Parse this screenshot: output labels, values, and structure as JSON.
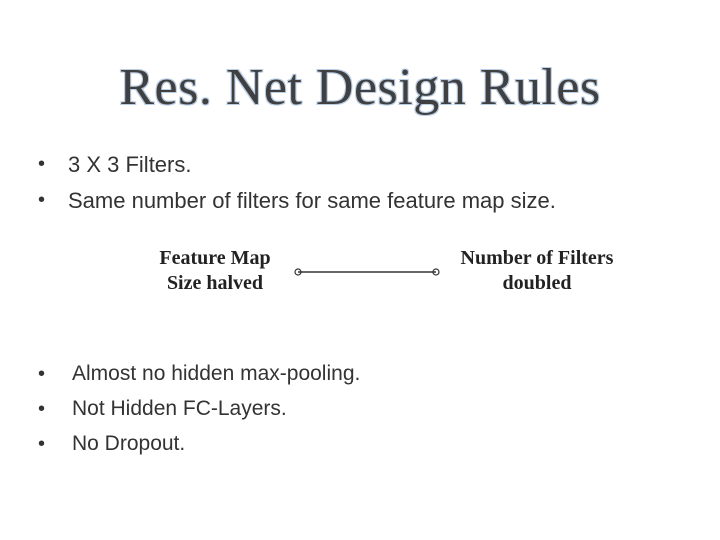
{
  "title": "Res. Net Design Rules",
  "bullets_top": [
    "3 X 3 Filters.",
    "Same number of filters for same feature map size."
  ],
  "diagram": {
    "left_line1": "Feature Map",
    "left_line2": "Size halved",
    "right_line1": "Number of Filters",
    "right_line2": "doubled"
  },
  "bullets_bottom": [
    "Almost no hidden max-pooling.",
    "Not Hidden FC-Layers.",
    "No Dropout."
  ]
}
